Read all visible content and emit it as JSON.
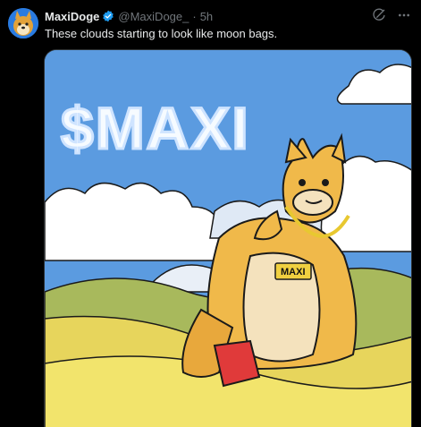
{
  "post": {
    "author_name": "MaxiDoge",
    "handle": "@MaxiDoge_",
    "separator": "·",
    "time": "5h",
    "text": "These clouds starting to look like moon bags.",
    "verified": true,
    "accent_color": "#1d9bf0"
  },
  "actions": {
    "grok_icon": "grok-icon",
    "more_icon": "more-icon",
    "more_label": "···"
  },
  "image": {
    "cloud_text": "$MAXI",
    "pendant_text": "MAXI"
  }
}
